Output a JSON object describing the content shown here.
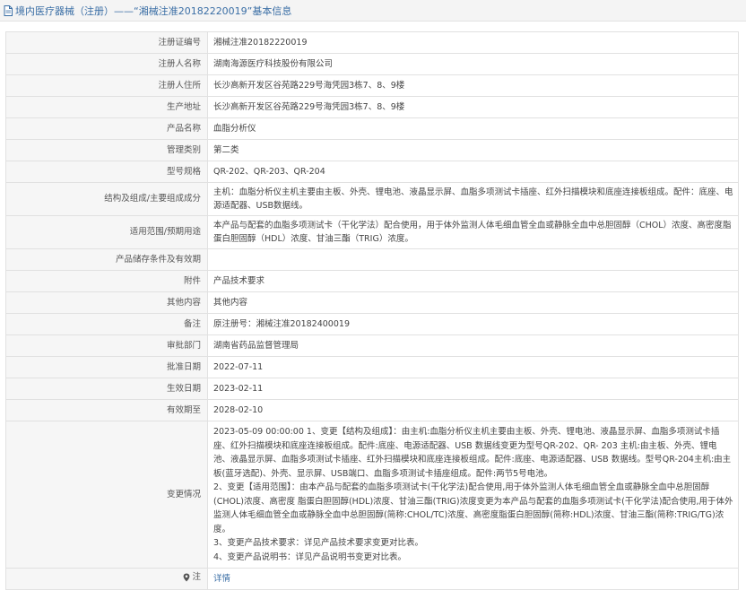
{
  "header": {
    "title": "境内医疗器械（注册）——“湘械注准20182220019”基本信息",
    "icon": "document-icon"
  },
  "accent_color": "#3a6ea5",
  "rows": [
    {
      "label": "注册证编号",
      "value": "湘械注准20182220019"
    },
    {
      "label": "注册人名称",
      "value": "湖南海源医疗科技股份有限公司"
    },
    {
      "label": "注册人住所",
      "value": "长沙高新开发区谷苑路229号海凭园3栋7、8、9楼"
    },
    {
      "label": "生产地址",
      "value": "长沙高新开发区谷苑路229号海凭园3栋7、8、9楼"
    },
    {
      "label": "产品名称",
      "value": "血脂分析仪"
    },
    {
      "label": "管理类别",
      "value": "第二类"
    },
    {
      "label": "型号规格",
      "value": "QR-202、QR-203、QR-204"
    },
    {
      "label": "结构及组成/主要组成成分",
      "value": "主机：血脂分析仪主机主要由主板、外壳、锂电池、液晶显示屏、血脂多项测试卡插座、红外扫描模块和底座连接板组成。配件：底座、电源适配器、USB数据线。"
    },
    {
      "label": "适用范围/预期用途",
      "value": "本产品与配套的血脂多项测试卡（干化学法）配合使用，用于体外监测人体毛细血管全血或静脉全血中总胆固醇（CHOL）浓度、高密度脂蛋白胆固醇（HDL）浓度、甘油三酯（TRIG）浓度。"
    },
    {
      "label": "产品储存条件及有效期",
      "value": ""
    },
    {
      "label": "附件",
      "value": "产品技术要求"
    },
    {
      "label": "其他内容",
      "value": "其他内容"
    },
    {
      "label": "备注",
      "value": "原注册号：湘械注准20182400019"
    },
    {
      "label": "审批部门",
      "value": "湖南省药品监督管理局"
    },
    {
      "label": "批准日期",
      "value": "2022-07-11"
    },
    {
      "label": "生效日期",
      "value": "2023-02-11"
    },
    {
      "label": "有效期至",
      "value": "2028-02-10"
    }
  ],
  "change": {
    "label": "变更情况",
    "lines": [
      "2023-05-09 00:00:00 1、变更【结构及组成】：由主机:血脂分析仪主机主要由主板、外壳、锂电池、液晶显示屏、血脂多项测试卡插座、红外扫描模块和底座连接板组成。配件:底座、电源适配器、USB 数据线变更为型号QR-202、QR- 203 主机:由主板、外壳、锂电池、液晶显示屏、血脂多项测试卡插座、红外扫描模块和底座连接板组成。配件:底座、电源适配器、USB 数据线。型号QR-204主机:由主板(蓝牙选配)、外壳、显示屏、USB端口、血脂多项测试卡插座组成。配件:两节5号电池。",
      "2、变更【适用范围】：由本产品与配套的血脂多项测试卡(干化学法)配合使用,用于体外监测人体毛细血管全血或静脉全血中总胆固醇(CHOL)浓度、高密度 脂蛋白胆固醇(HDL)浓度、甘油三酯(TRIG)浓度变更为本产品与配套的血脂多项测试卡(干化学法)配合使用,用于体外监测人体毛细血管全血或静脉全血中总胆固醇(简称:CHOL/TC)浓度、高密度脂蛋白胆固醇(简称:HDL)浓度、甘油三酯(简称:TRIG/TG)浓度。",
      "3、变更产品技术要求：详见产品技术要求变更对比表。",
      "4、变更产品说明书：详见产品说明书变更对比表。"
    ]
  },
  "note": {
    "label": "注",
    "icon": "location-pin-icon",
    "link": "详情"
  }
}
